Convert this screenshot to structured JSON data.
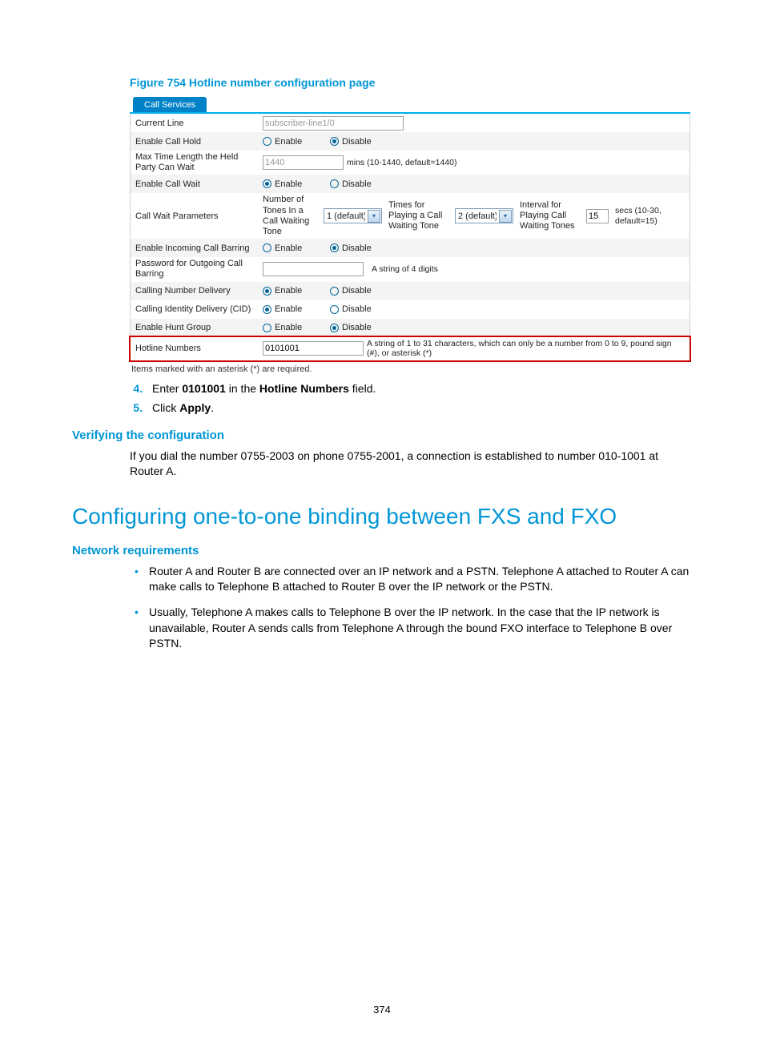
{
  "figure_caption": "Figure 754 Hotline number configuration page",
  "tab_label": "Call Services",
  "rows": {
    "current_line": {
      "label": "Current Line",
      "value": "subscriber-line1/0"
    },
    "call_hold": {
      "label": "Enable Call Hold",
      "enable": "Enable",
      "disable": "Disable",
      "selected": "disable"
    },
    "max_time": {
      "label": "Max Time Length the Held Party Can Wait",
      "value": "1440",
      "hint": "mins (10-1440, default=1440)"
    },
    "call_wait": {
      "label": "Enable Call Wait",
      "enable": "Enable",
      "disable": "Disable",
      "selected": "enable"
    },
    "cw_params": {
      "label": "Call Wait Parameters",
      "col1": "Number of Tones In a Call Waiting Tone",
      "sel1": "1 (default)",
      "col2": "Times for Playing a Call Waiting Tone",
      "sel2": "2 (default)",
      "col3": "Interval for Playing Call Waiting Tones",
      "val3": "15",
      "hint3": "secs (10-30, default=15)"
    },
    "incoming_barring": {
      "label": "Enable Incoming Call Barring",
      "enable": "Enable",
      "disable": "Disable",
      "selected": "disable"
    },
    "pw_barring": {
      "label": "Password for Outgoing Call Barring",
      "hint": "A string of 4 digits"
    },
    "cnd": {
      "label": "Calling Number Delivery",
      "enable": "Enable",
      "disable": "Disable",
      "selected": "enable"
    },
    "cid": {
      "label": "Calling Identity Delivery (CID)",
      "enable": "Enable",
      "disable": "Disable",
      "selected": "enable"
    },
    "hunt": {
      "label": "Enable Hunt Group",
      "enable": "Enable",
      "disable": "Disable",
      "selected": "disable"
    },
    "hotline": {
      "label": "Hotline Numbers",
      "value": "0101001",
      "hint": "A string of 1 to 31 characters, which can only be a number from 0 to 9, pound sign (#), or asterisk (*)"
    }
  },
  "form_note": "Items marked with an asterisk (*) are required.",
  "steps": {
    "s4": {
      "num": "4",
      "pre": "Enter ",
      "bold1": "0101001",
      "mid": " in the ",
      "bold2": "Hotline Numbers",
      "post": " field."
    },
    "s5": {
      "num": "5",
      "pre": "Click ",
      "bold1": "Apply",
      "post": "."
    }
  },
  "verify_heading": "Verifying the configuration",
  "verify_text": "If you dial the number 0755-2003 on phone 0755-2001, a connection is established to number 010-1001 at Router A.",
  "main_heading": "Configuring one-to-one binding between FXS and FXO",
  "netreq_heading": "Network requirements",
  "bullets": {
    "b1": "Router A and Router B are connected over an IP network and a PSTN. Telephone A attached to Router A can make calls to Telephone B attached to Router B over the IP network or the PSTN.",
    "b2": "Usually, Telephone A makes calls to Telephone B over the IP network. In the case that the IP network is unavailable, Router A sends calls from Telephone A through the bound FXO interface to Telephone B over PSTN."
  },
  "page_number": "374"
}
